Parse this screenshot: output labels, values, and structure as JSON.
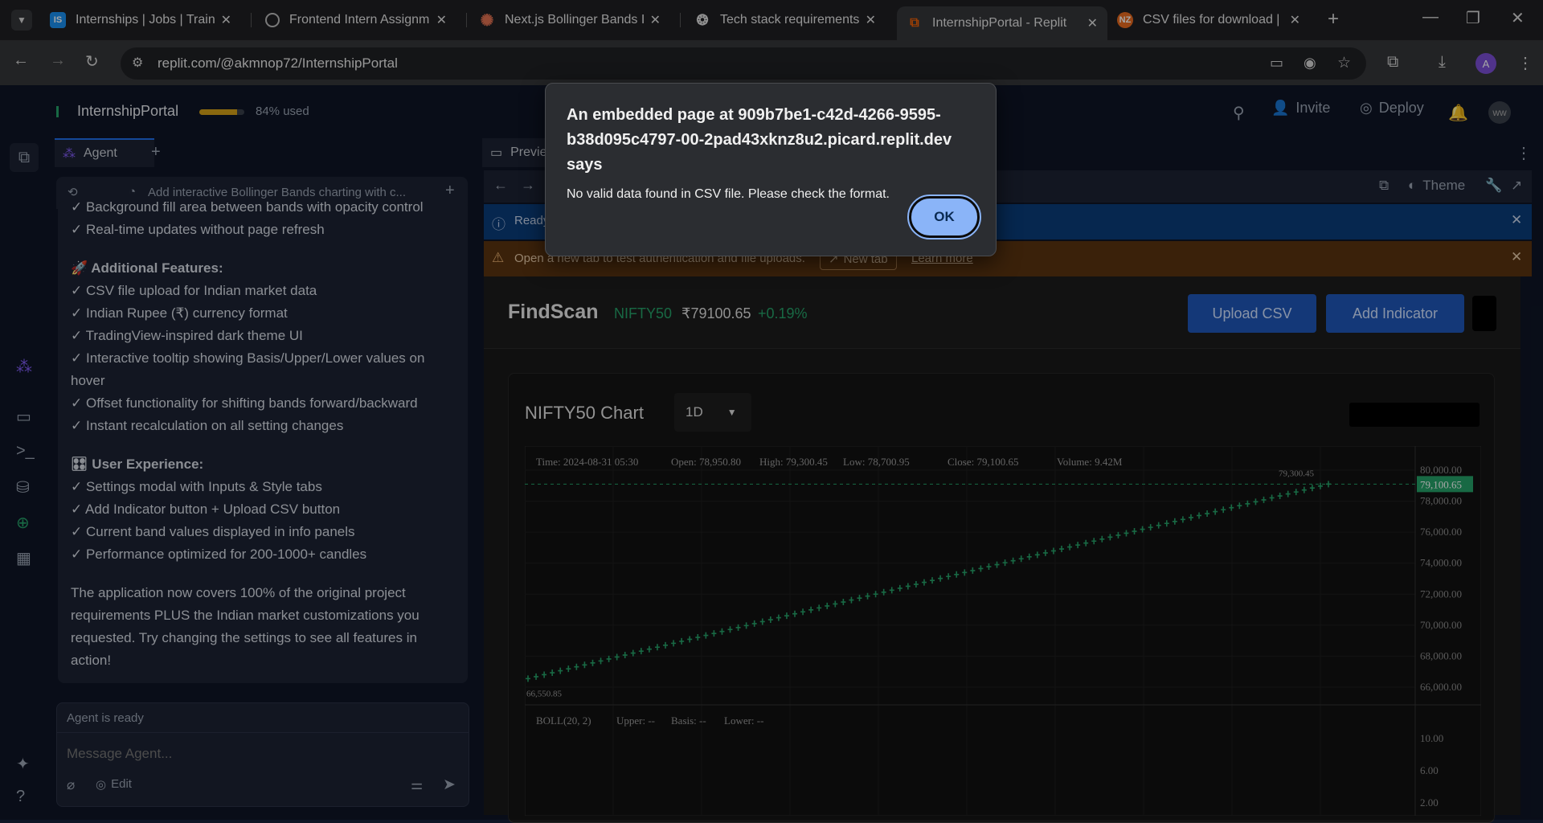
{
  "browser": {
    "tabs": [
      {
        "title": "Internships | Jobs | Training",
        "favicon": "IS"
      },
      {
        "title": "Frontend Intern Assignment",
        "favicon": "globe"
      },
      {
        "title": "Next.js Bollinger Bands Ind",
        "favicon": "claude"
      },
      {
        "title": "Tech stack requirements",
        "favicon": "openai"
      },
      {
        "title": "InternshipPortal - Replit",
        "favicon": "replit"
      },
      {
        "title": "CSV files for download | St",
        "favicon": "NZ"
      }
    ],
    "url": "replit.com/@akmnop72/InternshipPortal"
  },
  "replit": {
    "project_name": "InternshipPortal",
    "usage": "84% used",
    "usage_fraction": 0.84,
    "invite_label": "Invite",
    "deploy_label": "Deploy",
    "avatar": "ww",
    "agent_tab": "Agent",
    "preview_tab": "Previe",
    "theme_label": "Theme",
    "agent_task": "Add interactive Bollinger Bands charting with c...",
    "chat_lines_top": [
      "✓ Background fill area between bands with opacity control",
      "✓ Real-time updates without page refresh"
    ],
    "additional_heading": "🚀 Additional Features:",
    "additional_items": [
      "✓ CSV file upload for Indian market data",
      "✓ Indian Rupee (₹) currency format",
      "✓ TradingView-inspired dark theme UI",
      "✓ Interactive tooltip showing Basis/Upper/Lower values on",
      "hover",
      "✓ Offset functionality for shifting bands forward/backward",
      "✓ Instant recalculation on all setting changes"
    ],
    "ux_heading": "🎛 User Experience:",
    "ux_items": [
      "✓ Settings modal with Inputs & Style tabs",
      "✓ Add Indicator button + Upload CSV button",
      "✓ Current band values displayed in info panels",
      "✓ Performance optimized for 200-1000+ candles"
    ],
    "closing_paragraph": [
      "The application now covers 100% of the original project",
      "requirements PLUS the Indian market customizations you",
      "requested. Try changing the settings to see all features in",
      "action!"
    ],
    "agent_status": "Agent is ready",
    "message_placeholder": "Message Agent...",
    "edit_label": "Edit",
    "ready_banner": "Ready",
    "warn_banner": "Open a new tab to test authentication and file uploads.",
    "new_tab_label": "New tab",
    "learn_more_label": "Learn more"
  },
  "app": {
    "brand": "FindScan",
    "symbol": "NIFTY50",
    "price": "₹79100.65",
    "change": "+0.19%",
    "upload_label": "Upload CSV",
    "indicator_label": "Add Indicator",
    "chart_title": "NIFTY50 Chart",
    "interval": "1D",
    "ohlc": {
      "time": "Time: 2024-08-31 05:30",
      "open": "Open: 78,950.80",
      "high": "High: 79,300.45",
      "low": "Low: 78,700.95",
      "close": "Close: 79,100.65",
      "volume": "Volume: 9.42M"
    },
    "last_price_tag": "79,100.65",
    "high_marker": "79,300.45",
    "low_marker": "66,550.85",
    "boll": {
      "name": "BOLL(20, 2)",
      "upper": "Upper: --",
      "basis": "Basis: --",
      "lower": "Lower: --"
    },
    "price_axis": [
      "80,000.00",
      "78,000.00",
      "76,000.00",
      "74,000.00",
      "72,000.00",
      "70,000.00",
      "68,000.00",
      "66,000.00"
    ],
    "boll_axis": [
      "10.00",
      "6.00",
      "2.00"
    ]
  },
  "chart_data": {
    "type": "line",
    "x": [
      1,
      100
    ],
    "series": [
      {
        "values": [
          66550.85,
          79100.65
        ]
      }
    ],
    "ylim": [
      66000,
      80000
    ]
  },
  "dialog": {
    "title": "An embedded page at 909b7be1-c42d-4266-9595-b38d095c4797-00-2pad43xknz8u2.picard.replit.dev says",
    "message": "No valid data found in CSV file. Please check the format.",
    "ok_label": "OK"
  },
  "colors": {
    "green": "#26a269",
    "accent": "#1f6feb",
    "ok_button": "#8ab4f8"
  }
}
